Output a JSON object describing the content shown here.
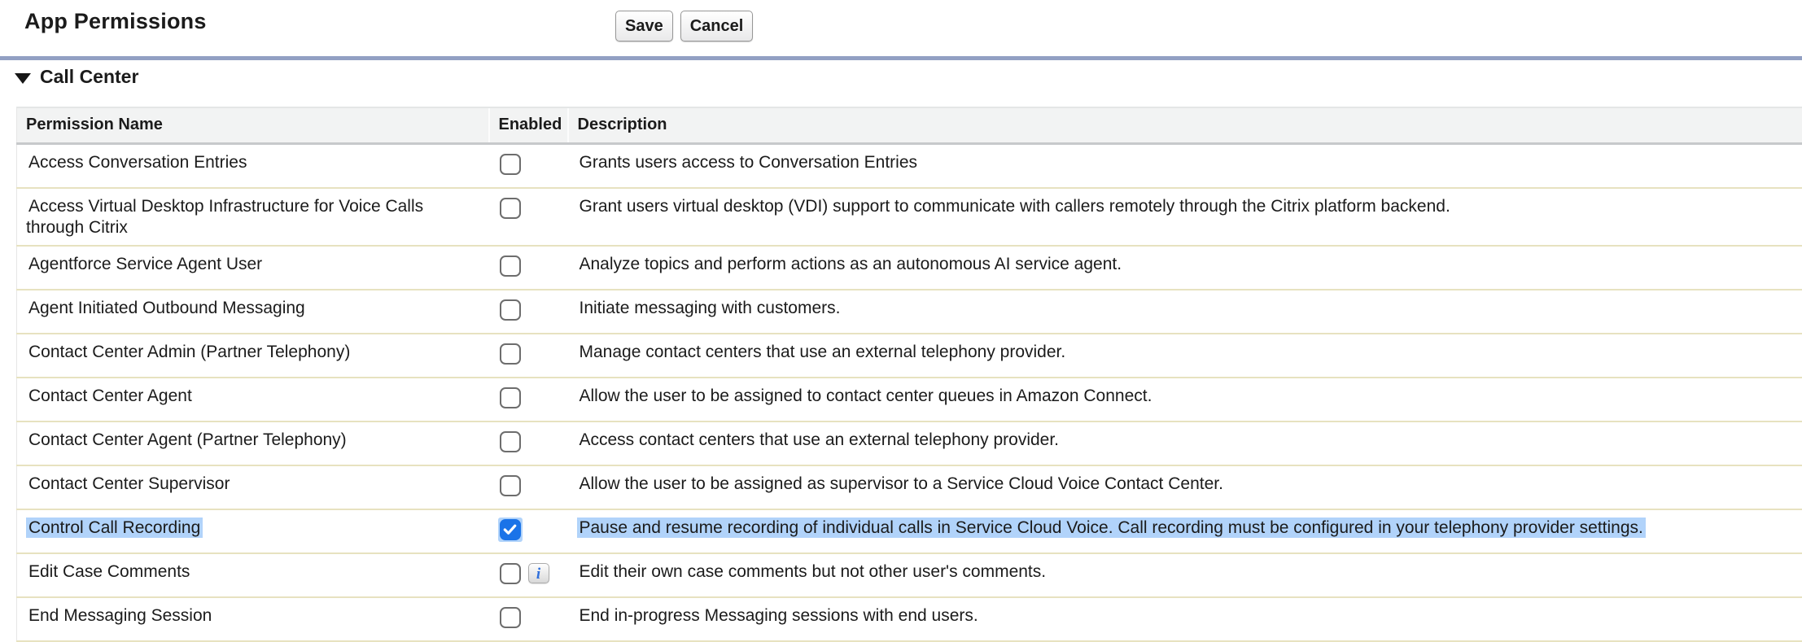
{
  "header": {
    "title": "App Permissions",
    "buttons": {
      "save": "Save",
      "cancel": "Cancel"
    }
  },
  "section": {
    "title": "Call Center",
    "collapse_icon": "triangle-down"
  },
  "table": {
    "columns": {
      "name": "Permission Name",
      "enabled": "Enabled",
      "description": "Description"
    },
    "rows": [
      {
        "name": "Access Conversation Entries",
        "enabled": false,
        "info": false,
        "highlighted": false,
        "description": "Grants users access to Conversation Entries"
      },
      {
        "name": "Access Virtual Desktop Infrastructure for Voice Calls through Citrix",
        "enabled": false,
        "info": false,
        "highlighted": false,
        "description": "Grant users virtual desktop (VDI) support to communicate with callers remotely through the Citrix platform backend."
      },
      {
        "name": "Agentforce Service Agent User",
        "enabled": false,
        "info": false,
        "highlighted": false,
        "description": "Analyze topics and perform actions as an autonomous AI service agent."
      },
      {
        "name": "Agent Initiated Outbound Messaging",
        "enabled": false,
        "info": false,
        "highlighted": false,
        "description": "Initiate messaging with customers."
      },
      {
        "name": "Contact Center Admin (Partner Telephony)",
        "enabled": false,
        "info": false,
        "highlighted": false,
        "description": "Manage contact centers that use an external telephony provider."
      },
      {
        "name": "Contact Center Agent",
        "enabled": false,
        "info": false,
        "highlighted": false,
        "description": "Allow the user to be assigned to contact center queues in Amazon Connect."
      },
      {
        "name": "Contact Center Agent (Partner Telephony)",
        "enabled": false,
        "info": false,
        "highlighted": false,
        "description": "Access contact centers that use an external telephony provider."
      },
      {
        "name": "Contact Center Supervisor",
        "enabled": false,
        "info": false,
        "highlighted": false,
        "description": "Allow the user to be assigned as supervisor to a Service Cloud Voice Contact Center."
      },
      {
        "name": "Control Call Recording",
        "enabled": true,
        "info": false,
        "highlighted": true,
        "description": "Pause and resume recording of individual calls in Service Cloud Voice. Call recording must be configured in your telephony provider settings."
      },
      {
        "name": "Edit Case Comments",
        "enabled": false,
        "info": true,
        "highlighted": false,
        "description": "Edit their own case comments but not other user's comments."
      },
      {
        "name": "End Messaging Session",
        "enabled": false,
        "info": false,
        "highlighted": false,
        "description": "End in-progress Messaging sessions with end users."
      }
    ]
  },
  "icons": {
    "info_glyph": "i"
  },
  "colors": {
    "divider_bar": "#92a0c3",
    "checkbox_checked": "#1a73e8",
    "selection_highlight": "#b1d3fa",
    "row_border": "#e7e2c0",
    "header_bg": "#f2f3f3"
  }
}
